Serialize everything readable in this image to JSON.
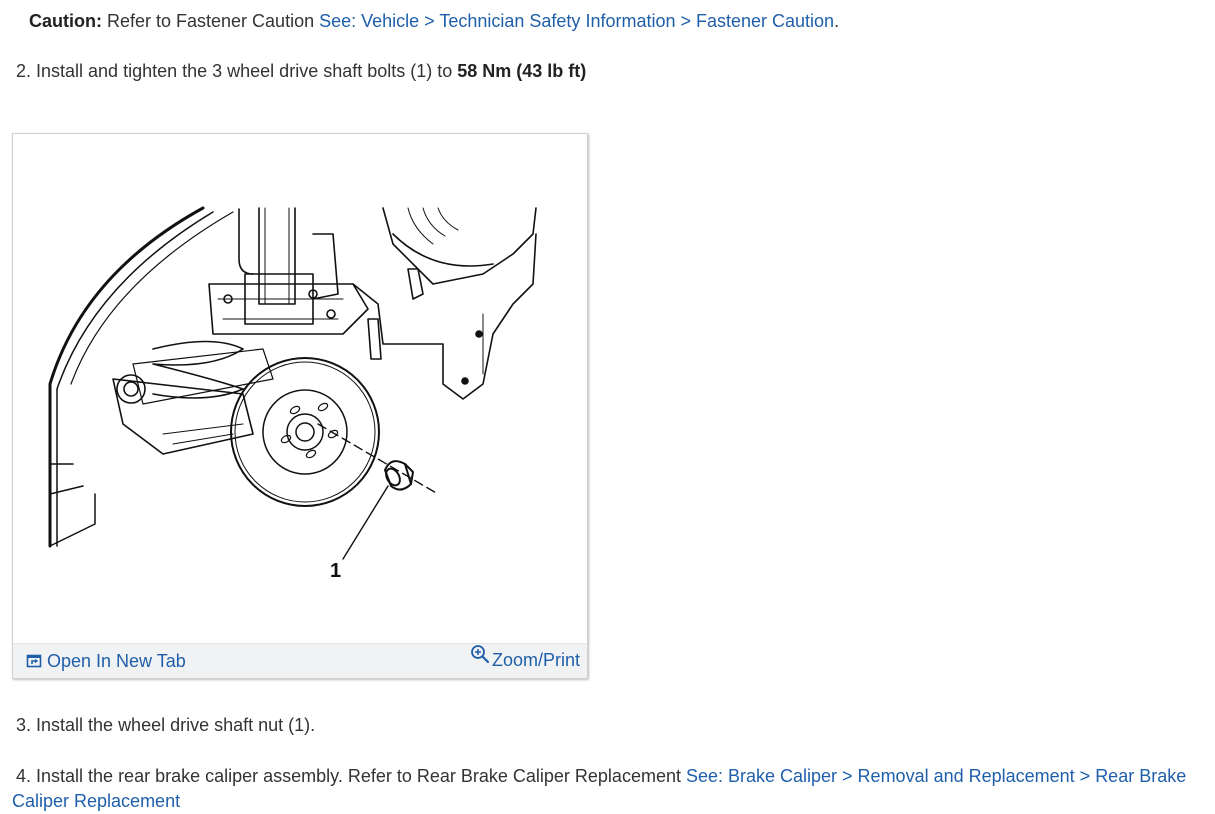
{
  "caution": {
    "label": "Caution:",
    "text": " Refer to Fastener Caution ",
    "link": "See: Vehicle > Technician Safety Information > Fastener Caution",
    "trailing": "."
  },
  "steps": [
    {
      "number": "2.",
      "text": " Install and tighten the 3 wheel drive shaft bolts (1) to ",
      "bold": "58 Nm (43 lb ft)"
    },
    {
      "number": "3.",
      "text": " Install the wheel drive shaft nut (1)."
    },
    {
      "number": "4.",
      "text": " Install the rear brake caliper assembly. Refer to Rear Brake Caliper Replacement ",
      "link": "See: Brake Caliper > Removal and Replacement > Rear Brake Caliper Replacement"
    }
  ],
  "figure": {
    "callout": "1",
    "open_tab_label": "Open In New Tab",
    "zoom_label": "Zoom/Print",
    "icons": [
      "open-new-tab-icon",
      "zoom-in-icon"
    ],
    "link_color": "#1f5faa",
    "bar_color": "#f1f2f4"
  }
}
